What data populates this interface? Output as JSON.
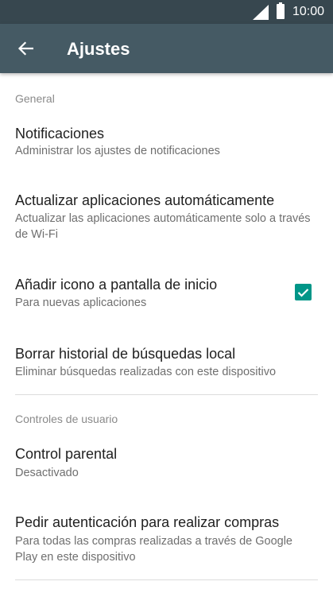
{
  "status_bar": {
    "time": "10:00"
  },
  "toolbar": {
    "title": "Ajustes",
    "back_icon": "arrow-left-icon"
  },
  "sections": {
    "general": {
      "header": "General",
      "notifications": {
        "title": "Notificaciones",
        "summary": "Administrar los ajustes de notificaciones"
      },
      "auto_update": {
        "title": "Actualizar aplicaciones automáticamente",
        "summary": "Actualizar las aplicaciones automáticamente solo a través de Wi-Fi"
      },
      "add_icon": {
        "title": "Añadir icono a pantalla de inicio",
        "summary": "Para nuevas aplicaciones",
        "checked": true
      },
      "clear_history": {
        "title": "Borrar historial de búsquedas  local",
        "summary": "Eliminar búsquedas realizadas con este dispositivo"
      }
    },
    "user_controls": {
      "header": "Controles de usuario",
      "parental": {
        "title": "Control parental",
        "summary": "Desactivado"
      },
      "purchase_auth": {
        "title": "Pedir autenticación para realizar compras",
        "summary": "Para todas las compras realizadas a través de Google Play en este dispositivo"
      }
    }
  },
  "colors": {
    "status_bar": "#37474f",
    "toolbar": "#455a64",
    "accent": "#009688"
  }
}
